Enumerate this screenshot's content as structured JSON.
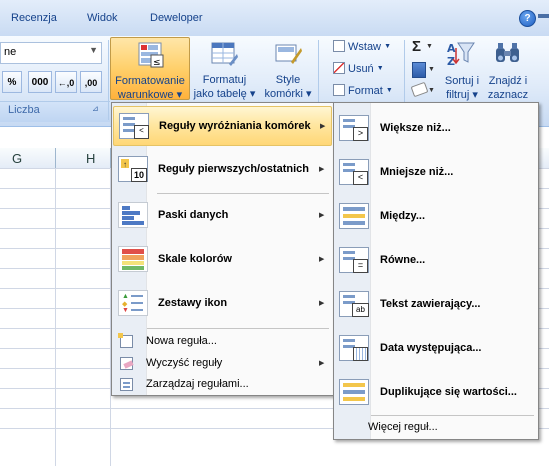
{
  "tabs": [
    "Recenzja",
    "Widok",
    "Deweloper"
  ],
  "help_icon": "question-mark-icon",
  "number_group": {
    "format_value": "ne",
    "buttons": [
      "%",
      "000",
      "←,0",
      ",00"
    ],
    "label": "Liczba"
  },
  "ribbon_buttons": {
    "conditional_formatting": [
      "Formatowanie",
      "warunkowe ▾"
    ],
    "format_as_table": [
      "Formatuj",
      "jako tabelę ▾"
    ],
    "cell_styles": [
      "Style",
      "komórki ▾"
    ]
  },
  "cells_group": {
    "insert": "Wstaw",
    "delete": "Usuń",
    "format": "Format"
  },
  "editing_group": {
    "sum_symbol": "Σ",
    "sort_filter": [
      "Sortuj i",
      "filtruj ▾"
    ],
    "find_select": [
      "Znajdź i",
      "zaznacz ▾"
    ]
  },
  "columns": [
    "G",
    "H"
  ],
  "main_menu": [
    {
      "label": "Reguły wyróżniania komórek",
      "icon": "highlight-rules-icon",
      "submenu": true,
      "highlighted": true
    },
    {
      "label": "Reguły pierwszych/ostatnich",
      "icon": "top-bottom-rules-icon",
      "submenu": true
    },
    {
      "label": "Paski danych",
      "icon": "data-bars-icon",
      "submenu": true
    },
    {
      "label": "Skale kolorów",
      "icon": "color-scales-icon",
      "submenu": true
    },
    {
      "label": "Zestawy ikon",
      "icon": "icon-sets-icon",
      "submenu": true
    }
  ],
  "main_menu_small": [
    {
      "label": "Nowa reguła...",
      "icon": "new-rule-icon"
    },
    {
      "label": "Wyczyść reguły",
      "icon": "clear-rules-icon",
      "submenu": true
    },
    {
      "label": "Zarządzaj regułami...",
      "icon": "manage-rules-icon"
    }
  ],
  "sub_menu": [
    {
      "label": "Większe niż...",
      "icon": "greater-than-icon"
    },
    {
      "label": "Mniejsze niż...",
      "icon": "less-than-icon"
    },
    {
      "label": "Między...",
      "icon": "between-icon"
    },
    {
      "label": "Równe...",
      "icon": "equal-to-icon"
    },
    {
      "label": "Tekst zawierający...",
      "icon": "text-contains-icon"
    },
    {
      "label": "Data występująca...",
      "icon": "date-occurring-icon"
    },
    {
      "label": "Duplikujące się wartości...",
      "icon": "duplicate-values-icon"
    }
  ],
  "sub_menu_more": "Więcej reguł..."
}
